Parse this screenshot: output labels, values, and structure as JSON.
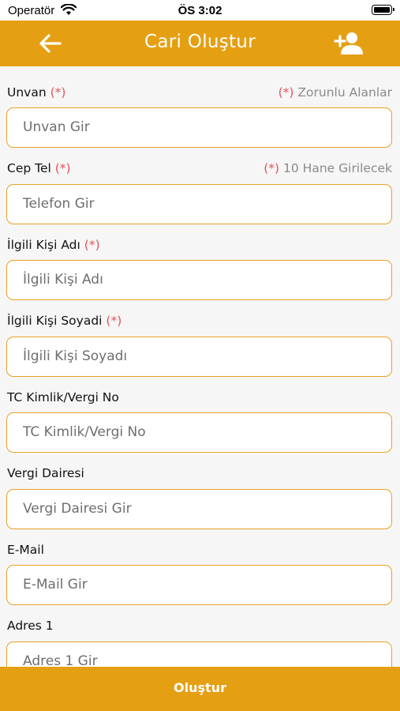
{
  "status_bar": {
    "carrier": "Operatör",
    "time": "ÖS 3:02"
  },
  "app_bar": {
    "title": "Cari Oluştur"
  },
  "form": {
    "required_marker": "(*)",
    "fields": [
      {
        "label": "Unvan",
        "required": true,
        "hint_marker": "(*)",
        "hint_text": "Zorunlu Alanlar",
        "placeholder": "Unvan Gir"
      },
      {
        "label": "Cep Tel",
        "required": true,
        "hint_marker": "(*)",
        "hint_text": "10 Hane Girilecek",
        "placeholder": "Telefon Gir"
      },
      {
        "label": "İlgili Kişi Adı",
        "required": true,
        "placeholder": "İlgili Kişi Adı"
      },
      {
        "label": "İlgili Kişi Soyadi",
        "required": true,
        "placeholder": "İlgili Kişi Soyadı"
      },
      {
        "label": "TC Kimlik/Vergi No",
        "required": false,
        "placeholder": "TC Kimlik/Vergi No"
      },
      {
        "label": "Vergi Dairesi",
        "required": false,
        "placeholder": "Vergi Dairesi Gir"
      },
      {
        "label": "E-Mail",
        "required": false,
        "placeholder": "E-Mail Gir"
      },
      {
        "label": "Adres 1",
        "required": false,
        "placeholder": "Adres 1 Gir"
      }
    ]
  },
  "submit": {
    "label": "Oluştur"
  },
  "colors": {
    "accent": "#e59f12",
    "required": "#e2545b",
    "border": "#e5a227"
  }
}
